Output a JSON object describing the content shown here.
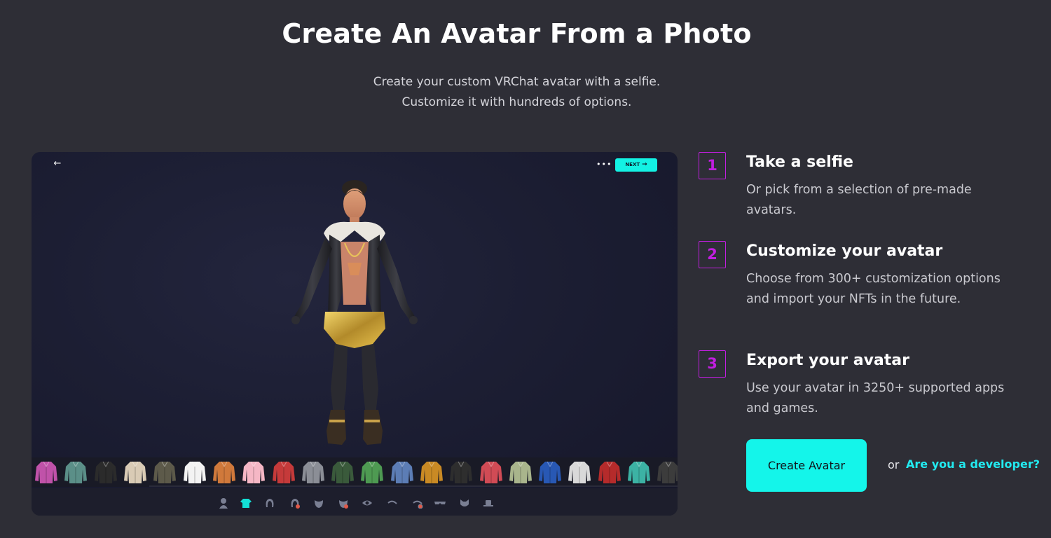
{
  "header": {
    "title": "Create An Avatar From a Photo",
    "subtitle_line1": "Create your custom VRChat avatar with a selfie.",
    "subtitle_line2": "Customize it with hundreds of options."
  },
  "preview": {
    "next_label": "NEXT",
    "back_icon": "arrow-left-icon",
    "more_icon": "more-dots-icon",
    "outfits": [
      {
        "color": "#c052a9"
      },
      {
        "color": "#5b8f88"
      },
      {
        "color": "#2b2b2b"
      },
      {
        "color": "#d9cbb5"
      },
      {
        "color": "#5d5a4a"
      },
      {
        "color": "#f3f3f3"
      },
      {
        "color": "#d0793b"
      },
      {
        "color": "#f5b7c5"
      },
      {
        "color": "#c53a3a"
      },
      {
        "color": "#8b8e96"
      },
      {
        "color": "#3a5a3b"
      },
      {
        "color": "#4e9a52"
      },
      {
        "color": "#5c7db5"
      },
      {
        "color": "#c98a24"
      },
      {
        "color": "#2e2e2e"
      },
      {
        "color": "#d14b55"
      },
      {
        "color": "#a9b58c"
      },
      {
        "color": "#2858b4"
      },
      {
        "color": "#d9d9d9"
      },
      {
        "color": "#b52b2b"
      },
      {
        "color": "#3cb2a4"
      },
      {
        "color": "#3c3c3c"
      }
    ],
    "categories": [
      {
        "icon": "body-icon",
        "color": "#7a7f93"
      },
      {
        "icon": "shirt-icon",
        "color": "#13e0d6"
      },
      {
        "icon": "hair-icon",
        "color": "#7a7f93"
      },
      {
        "icon": "hair-color-icon",
        "color": "#7a7f93"
      },
      {
        "icon": "beard-icon",
        "color": "#7a7f93"
      },
      {
        "icon": "beard-color-icon",
        "color": "#7a7f93"
      },
      {
        "icon": "eye-icon",
        "color": "#7a7f93"
      },
      {
        "icon": "eyebrow-icon",
        "color": "#7a7f93"
      },
      {
        "icon": "eyebrow-color-icon",
        "color": "#7a7f93"
      },
      {
        "icon": "glasses-icon",
        "color": "#7a7f93"
      },
      {
        "icon": "mask-icon",
        "color": "#7a7f93"
      },
      {
        "icon": "hat-icon",
        "color": "#7a7f93"
      }
    ]
  },
  "steps": [
    {
      "number": "1",
      "title": "Take a selfie",
      "desc": "Or pick from a selection of pre-made avatars."
    },
    {
      "number": "2",
      "title": "Customize your avatar",
      "desc": "Choose from 300+ customization options and import your NFTs in the future."
    },
    {
      "number": "3",
      "title": "Export your avatar",
      "desc": "Use your avatar in 3250+ supported apps and games."
    }
  ],
  "cta": {
    "button_label": "Create Avatar",
    "or_text": "or",
    "developer_link": "Are you a developer?"
  },
  "colors": {
    "accent_cyan": "#14f5ea",
    "accent_purple": "#c21fe0",
    "background": "#2e2e36"
  }
}
